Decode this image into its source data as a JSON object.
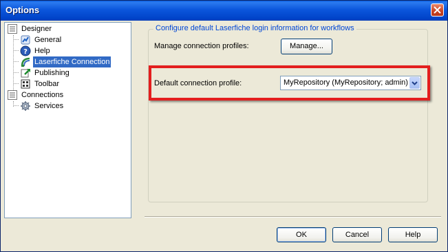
{
  "window": {
    "title": "Options"
  },
  "tree": {
    "items": [
      {
        "label": "Designer",
        "icon": "list-icon"
      },
      {
        "label": "General",
        "icon": "general-icon"
      },
      {
        "label": "Help",
        "icon": "help-icon"
      },
      {
        "label": "Laserfiche Connection",
        "icon": "laserfiche-icon",
        "selected": true
      },
      {
        "label": "Publishing",
        "icon": "publishing-icon"
      },
      {
        "label": "Toolbar",
        "icon": "toolbar-icon"
      },
      {
        "label": "Connections",
        "icon": "list-icon"
      },
      {
        "label": "Services",
        "icon": "gear-icon"
      }
    ]
  },
  "panel": {
    "group_title": "Configure default Laserfiche login information for workflows",
    "manage_label": "Manage connection profiles:",
    "manage_button": "Manage...",
    "default_label": "Default connection profile:",
    "default_value": "MyRepository   (MyRepository; admin)"
  },
  "buttons": {
    "ok": "OK",
    "cancel": "Cancel",
    "help": "Help"
  },
  "colors": {
    "highlight": "#e31e1e",
    "selection": "#316ac5",
    "titlebar": "#0054e3"
  }
}
